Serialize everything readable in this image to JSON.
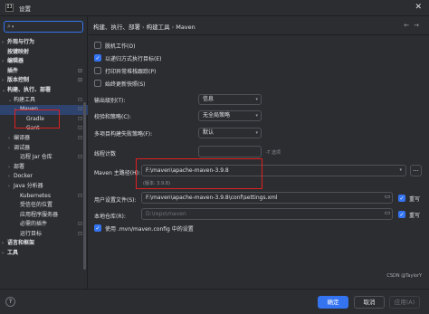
{
  "window": {
    "title": "设置",
    "app_icon_text": "IJ"
  },
  "search": {
    "placeholder": ""
  },
  "sidebar": {
    "items": [
      {
        "label": "外观与行为",
        "chevron": "›",
        "bold": true,
        "indent": 1,
        "gear": false
      },
      {
        "label": "按键映射",
        "chevron": "",
        "bold": true,
        "indent": 1,
        "gear": false
      },
      {
        "label": "编辑器",
        "chevron": "›",
        "bold": true,
        "indent": 1,
        "gear": false
      },
      {
        "label": "插件",
        "chevron": "",
        "bold": true,
        "indent": 1,
        "gear": true
      },
      {
        "label": "版本控制",
        "chevron": "›",
        "bold": true,
        "indent": 1,
        "gear": true
      },
      {
        "label": "构建、执行、部署",
        "chevron": "⌄",
        "bold": true,
        "indent": 1,
        "gear": false
      },
      {
        "label": "构建工具",
        "chevron": "⌄",
        "bold": false,
        "indent": 2,
        "gear": true
      },
      {
        "label": "Maven",
        "chevron": "›",
        "bold": false,
        "indent": 3,
        "gear": true,
        "selected": true
      },
      {
        "label": "Gradle",
        "chevron": "",
        "bold": false,
        "indent": 4,
        "gear": true
      },
      {
        "label": "Gant",
        "chevron": "",
        "bold": false,
        "indent": 4,
        "gear": true
      },
      {
        "label": "编译器",
        "chevron": "›",
        "bold": false,
        "indent": 2,
        "gear": true
      },
      {
        "label": "调试器",
        "chevron": "›",
        "bold": false,
        "indent": 2,
        "gear": false
      },
      {
        "label": "远程 Jar 仓库",
        "chevron": "",
        "bold": false,
        "indent": 3,
        "gear": true
      },
      {
        "label": "部署",
        "chevron": "›",
        "bold": false,
        "indent": 2,
        "gear": false
      },
      {
        "label": "Docker",
        "chevron": "›",
        "bold": false,
        "indent": 2,
        "gear": false
      },
      {
        "label": "Java 分析器",
        "chevron": "›",
        "bold": false,
        "indent": 2,
        "gear": false
      },
      {
        "label": "Kubernetes",
        "chevron": "",
        "bold": false,
        "indent": 3,
        "gear": true
      },
      {
        "label": "受信任的位置",
        "chevron": "",
        "bold": false,
        "indent": 3,
        "gear": false
      },
      {
        "label": "应用程序服务器",
        "chevron": "",
        "bold": false,
        "indent": 3,
        "gear": false
      },
      {
        "label": "必需的插件",
        "chevron": "",
        "bold": false,
        "indent": 3,
        "gear": true
      },
      {
        "label": "运行目标",
        "chevron": "",
        "bold": false,
        "indent": 3,
        "gear": true
      },
      {
        "label": "语言和框架",
        "chevron": "›",
        "bold": true,
        "indent": 1,
        "gear": false
      },
      {
        "label": "工具",
        "chevron": "›",
        "bold": true,
        "indent": 1,
        "gear": false
      }
    ]
  },
  "breadcrumb": {
    "items": [
      "构建、执行、部署",
      "构建工具",
      "Maven"
    ],
    "sep": "›"
  },
  "nav": {
    "back": "←",
    "forward": "→"
  },
  "checkboxes": [
    {
      "label": "脱机工作(O)",
      "checked": false
    },
    {
      "label": "以递归方式执行目标(E)",
      "checked": true
    },
    {
      "label": "打印异常堆栈跟踪(P)",
      "checked": false
    },
    {
      "label": "始终更新快照(S)",
      "checked": false
    }
  ],
  "fields": {
    "output_level": {
      "label": "输出级别(T):",
      "value": "信息"
    },
    "checksum_policy": {
      "label": "校验和策略(C):",
      "value": "无全局策略"
    },
    "multiproject_failure": {
      "label": "多项目构建失败策略(F):",
      "value": "默认"
    },
    "thread_count": {
      "label": "线程计数",
      "value": "",
      "hint": "-T 选项"
    },
    "maven_home": {
      "label": "Maven 主路径(H):",
      "value": "F:\\maven\\apache-maven-3.9.8",
      "version": "(版本: 3.9.8)",
      "more": "..."
    },
    "user_settings": {
      "label": "用户设置文件(S):",
      "value": "F:\\maven\\apache-maven-3.9.8\\conf\\settings.xml",
      "override_label": "重写",
      "override_checked": true
    },
    "local_repo": {
      "label": "本地仓库(R):",
      "value": "D:\\repo\\maven",
      "override_label": "重写",
      "override_checked": true
    },
    "use_config": {
      "label": "使用 .mvn/maven.config 中的设置",
      "checked": true
    }
  },
  "footer": {
    "help": "?",
    "ok": "确定",
    "cancel": "取消",
    "apply": "应用(A)"
  },
  "watermark": "CSDN @TaylorY",
  "colors": {
    "accent": "#3574f0",
    "highlight": "#e02020",
    "background": "#2b2d30"
  }
}
